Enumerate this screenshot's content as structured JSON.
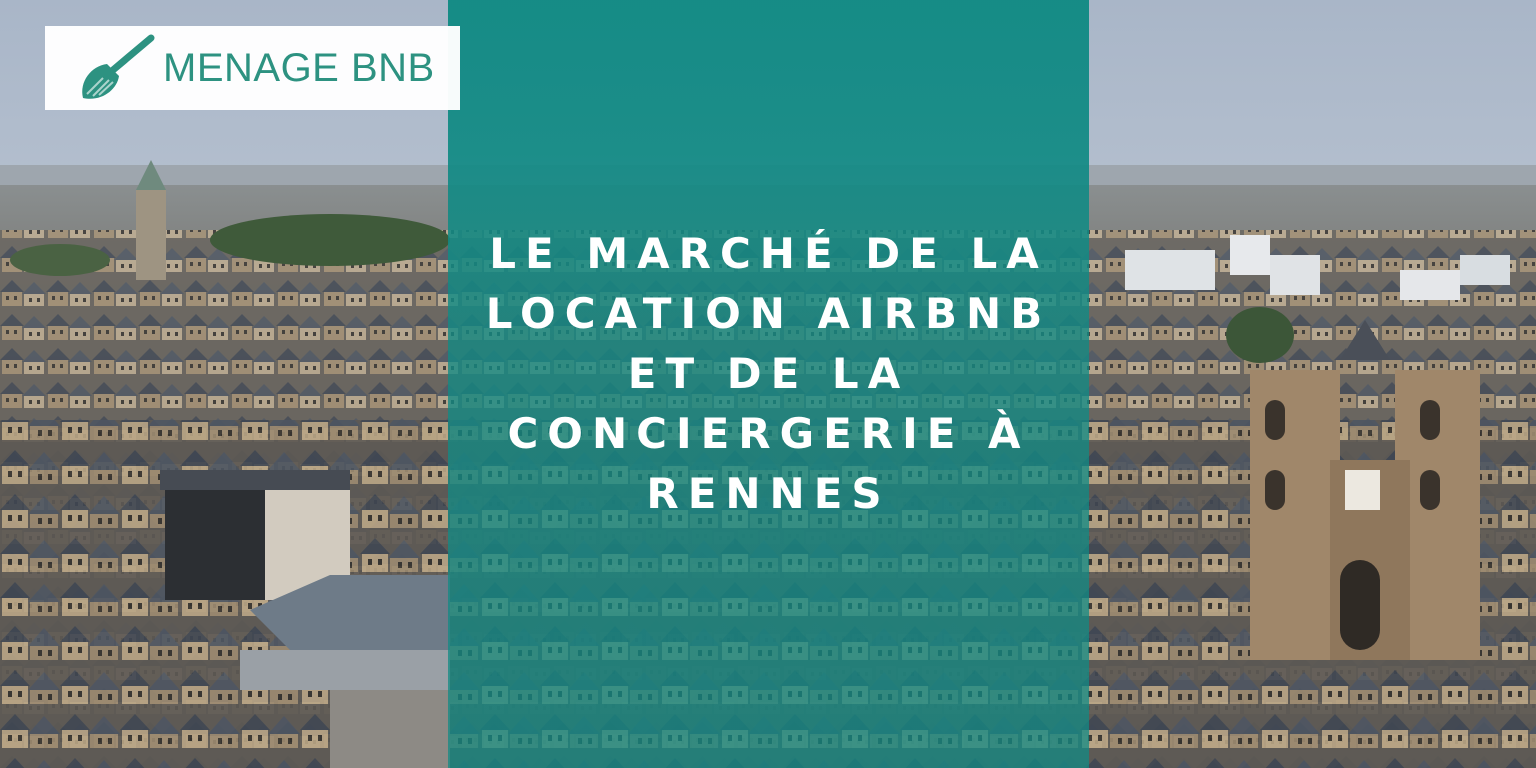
{
  "logo": {
    "brand_name": "MENAGE BNB",
    "icon": "broom-icon",
    "color": "#2d9281"
  },
  "headline": {
    "lines": [
      "LE MARCHÉ DE LA",
      "LOCATION AIRBNB",
      "ET DE LA",
      "CONCIERGERIE À",
      "RENNES"
    ]
  },
  "colors": {
    "panel_teal": "#118a84",
    "sky": "#b9c4d2",
    "roof_slate": "#4a5260",
    "stone": "#b09a7a"
  }
}
